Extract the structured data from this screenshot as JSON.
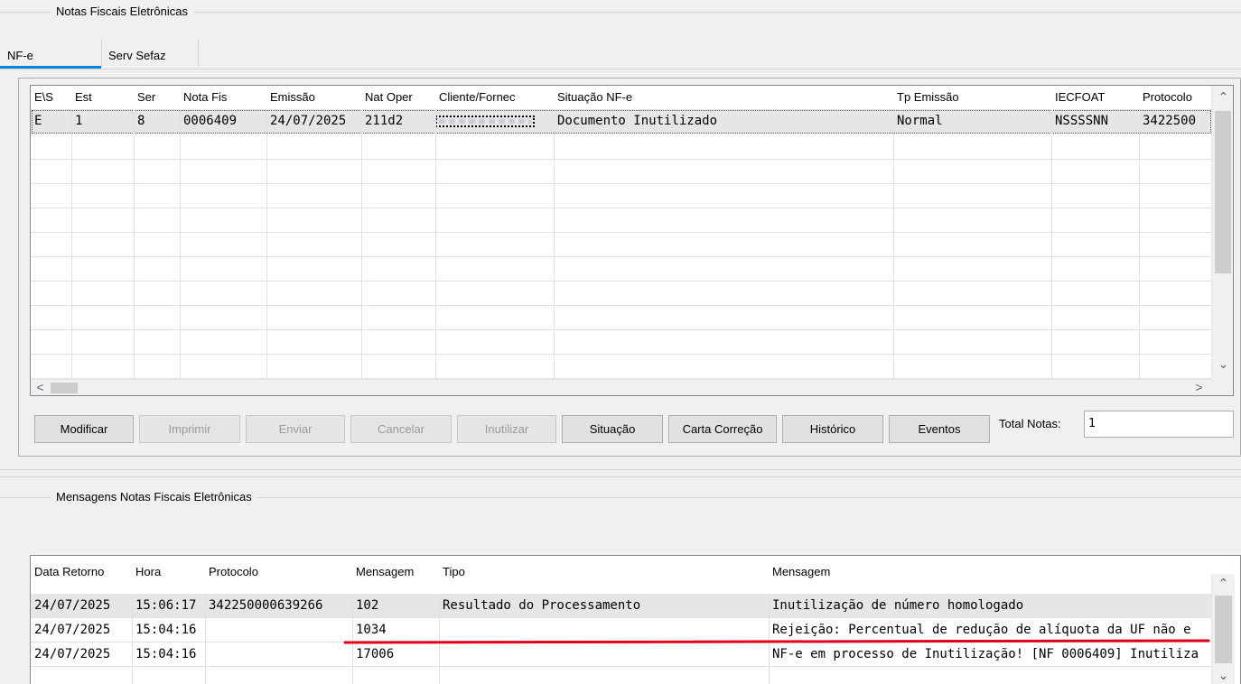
{
  "nfe_group": {
    "title": "Notas Fiscais Eletrônicas"
  },
  "tabs": [
    {
      "label": "NF-e",
      "active": true
    },
    {
      "label": "Serv Sefaz",
      "active": false
    }
  ],
  "nfe_grid": {
    "columns": [
      "E\\S",
      "Est",
      "Ser",
      "Nota Fis",
      "Emissão",
      "Nat Oper",
      "Cliente/Fornec",
      "Situação NF-e",
      "Tp Emissão",
      "IECFOAT",
      "Protocolo"
    ],
    "rows": [
      [
        "E",
        "1",
        "8",
        "0006409",
        "24/07/2025",
        "211d2",
        "",
        "Documento Inutilizado",
        "Normal",
        "NSSSSNN",
        "3422500"
      ]
    ]
  },
  "buttons": {
    "modificar": "Modificar",
    "imprimir": "Imprimir",
    "enviar": "Enviar",
    "cancelar": "Cancelar",
    "inutilizar": "Inutilizar",
    "situacao": "Situação",
    "carta_correcao": "Carta Correção",
    "historico": "Histórico",
    "eventos": "Eventos"
  },
  "total_notas": {
    "label": "Total Notas:",
    "value": "1"
  },
  "msg_group": {
    "title": "Mensagens Notas Fiscais Eletrônicas"
  },
  "msg_grid": {
    "columns": [
      "Data Retorno",
      "Hora",
      "Protocolo",
      "Mensagem",
      "Tipo",
      "Mensagem"
    ],
    "rows": [
      [
        "24/07/2025",
        "15:06:17",
        "342250000639266",
        "102",
        "Resultado do Processamento",
        "Inutilização de número homologado"
      ],
      [
        "24/07/2025",
        "15:04:16",
        "",
        "1034",
        "",
        "Rejeição: Percentual de redução de alíquota da UF não e"
      ],
      [
        "24/07/2025",
        "15:04:16",
        "",
        "17006",
        "",
        "NF-e em processo de Inutilização! [NF 0006409] Inutiliza"
      ]
    ]
  },
  "colors": {
    "tab_underline": "#0a84d9",
    "annotation_line": "#e0001b"
  },
  "icons": [
    "chevron-up-icon",
    "chevron-down-icon",
    "chevron-left-icon",
    "chevron-right-icon"
  ]
}
